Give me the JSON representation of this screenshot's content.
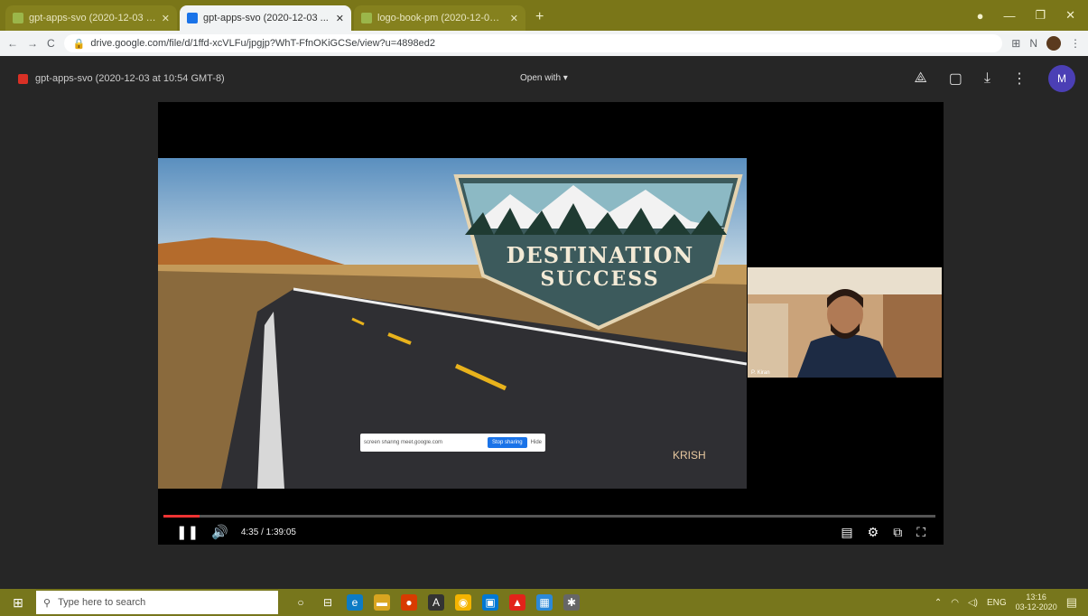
{
  "browser": {
    "tabs": [
      {
        "title": "gpt-apps-svo (2020-12-03 at 13...",
        "color": "#9bb64a"
      },
      {
        "title": "gpt-apps-svo (2020-12-03 ...",
        "color": "#1a73e8",
        "active": true
      },
      {
        "title": "logo-book-pm (2020-12-03 at 12...",
        "color": "#9bb64a"
      }
    ],
    "new_tab": "+",
    "window": {
      "minimize": "—",
      "maximize": "❐",
      "close": "✕"
    },
    "nav": {
      "back": "←",
      "forward": "→",
      "reload": "C"
    },
    "url": "drive.google.com/file/d/1ffd-xcVLFu/jpgjp?WhT-FfnOKiGCSe/view?u=4898ed2",
    "extension_icon": "⊞",
    "profile_label": "N"
  },
  "viewer": {
    "file_title": "gpt-apps-svo (2020-12-03 at 10:54 GMT-8)",
    "open_with": "Open with ▾",
    "icons": [
      "drive-add-icon",
      "comment-icon",
      "download-icon",
      "more-icon"
    ],
    "account_initial": "M"
  },
  "video": {
    "slide": {
      "line1": "DESTINATION",
      "line2": "SUCCESS",
      "watermark": "KRISH",
      "notice": "screen sharing meet.google.com",
      "notice_button": "Stop sharing",
      "notice_hide": "Hide"
    },
    "webcam_label": "P. Kiran",
    "time": "4:35 / 1:39:05",
    "progress": 0.047,
    "controls": {
      "play_pause": "❚❚",
      "volume": "🔊",
      "captions": "▤",
      "settings": "⚙",
      "miniplayer": "⧉",
      "fullscreen": "⛶"
    }
  },
  "taskbar": {
    "search_placeholder": "Type here to search",
    "apps": [
      {
        "name": "cortana-icon",
        "glyph": "○",
        "color": "#77761c"
      },
      {
        "name": "task-view-icon",
        "glyph": "⊟",
        "color": "#77761c"
      },
      {
        "name": "edge-icon",
        "glyph": "e",
        "color": "#0d7bc4"
      },
      {
        "name": "file-explorer-icon",
        "glyph": "▬",
        "color": "#d9a520"
      },
      {
        "name": "office-icon",
        "glyph": "●",
        "color": "#d83b01"
      },
      {
        "name": "autocad-icon",
        "glyph": "A",
        "color": "#333333"
      },
      {
        "name": "chrome-icon",
        "glyph": "◉",
        "color": "#f4b400"
      },
      {
        "name": "store-icon",
        "glyph": "▣",
        "color": "#0078d4"
      },
      {
        "name": "acrobat-icon",
        "glyph": "▲",
        "color": "#e2231a"
      },
      {
        "name": "photos-icon",
        "glyph": "▦",
        "color": "#2b88d8"
      },
      {
        "name": "settings-icon",
        "glyph": "✱",
        "color": "#666666"
      }
    ],
    "tray_lang": "ENG",
    "time": "13:16",
    "date": "03-12-2020",
    "notification_icon": "▤"
  }
}
